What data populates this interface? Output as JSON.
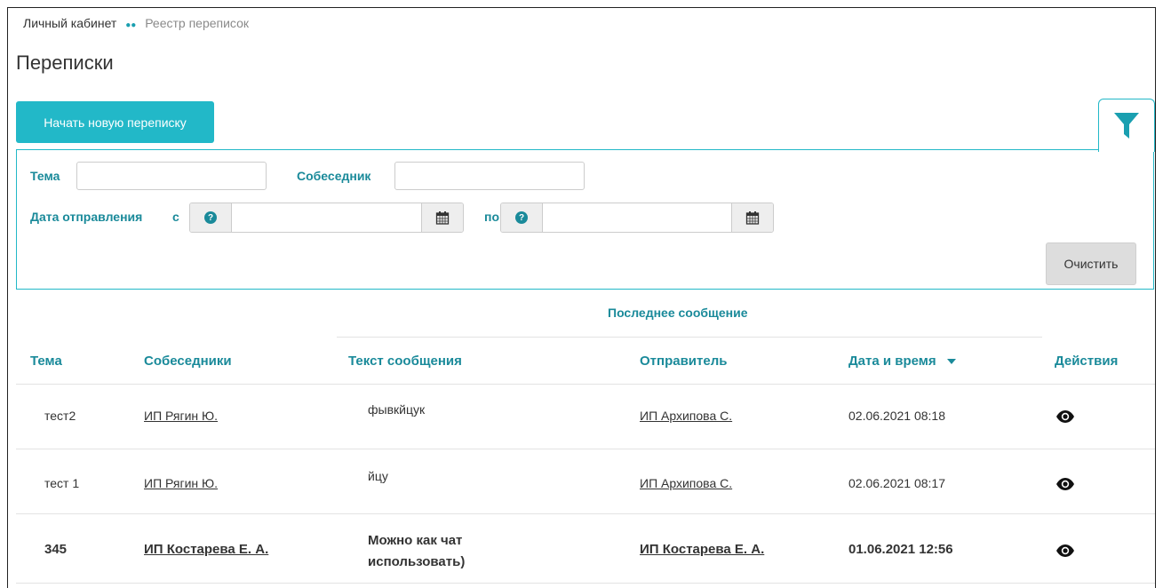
{
  "breadcrumb": {
    "home": "Личный кабинет",
    "current": "Реестр переписок"
  },
  "page": {
    "title": "Переписки"
  },
  "actions": {
    "new_label": "Начать новую переписку"
  },
  "filter": {
    "subject_label": "Тема",
    "subject_value": "",
    "partner_label": "Собеседник",
    "partner_value": "",
    "date_label": "Дата отправления",
    "from_label": "с",
    "from_value": "",
    "to_label": "по",
    "to_value": "",
    "clear_label": "Очистить"
  },
  "table": {
    "group_header": "Последнее сообщение",
    "headers": {
      "subject": "Тема",
      "partners": "Собеседники",
      "text": "Текст сообщения",
      "sender": "Отправитель",
      "datetime": "Дата и время",
      "actions": "Действия"
    },
    "rows": [
      {
        "subject": "тест2",
        "partner": "ИП Рягин Ю.",
        "text": "фывкйцук",
        "sender": "ИП Архипова С.",
        "datetime": "02.06.2021 08:18",
        "unread": false
      },
      {
        "subject": "тест 1",
        "partner": "ИП Рягин Ю.",
        "text": "йцу",
        "sender": "ИП Архипова С.",
        "datetime": "02.06.2021 08:17",
        "unread": false
      },
      {
        "subject": "345",
        "partner": "ИП Костарева Е. А.",
        "text": "Можно как чат использовать)",
        "sender": "ИП Костарева Е. А.",
        "datetime": "01.06.2021 12:56",
        "unread": true
      }
    ]
  },
  "colors": {
    "accent": "#22b8c8",
    "label": "#1a8a9a"
  }
}
